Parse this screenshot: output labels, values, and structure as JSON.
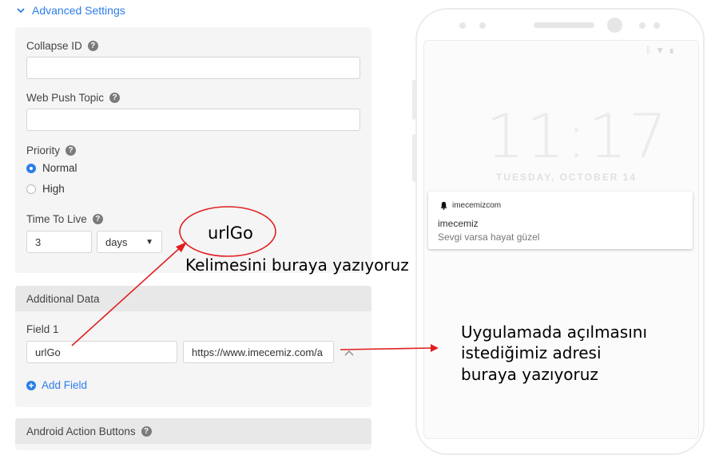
{
  "advanced_settings": {
    "label": "Advanced Settings"
  },
  "form": {
    "collapse_id": {
      "label": "Collapse ID",
      "value": ""
    },
    "web_push_topic": {
      "label": "Web Push Topic",
      "value": ""
    },
    "priority": {
      "label": "Priority",
      "options": [
        "Normal",
        "High"
      ],
      "selected": "Normal"
    },
    "time_to_live": {
      "label": "Time To Live",
      "value": "3",
      "unit": "days"
    }
  },
  "additional_data": {
    "title": "Additional Data",
    "field_label": "Field 1",
    "key": "urlGo",
    "value": "https://www.imecemiz.com/a",
    "add_field": "Add Field"
  },
  "android_action_buttons": {
    "title": "Android Action Buttons"
  },
  "phone": {
    "time": "11:17",
    "date": "TUESDAY, OCTOBER 14",
    "notification": {
      "app": "imecemizcom",
      "title": "imecemiz",
      "body": "Sevgi varsa hayat güzel"
    }
  },
  "annotations": {
    "circle_word": "urlGo",
    "left_note": "Kelimesini buraya yazıyoruz",
    "right_note": [
      "Uygulamada açılmasını",
      "istediğimiz adresi",
      "buraya yazıyoruz"
    ]
  },
  "colors": {
    "accent": "#2b7de9",
    "annotation_red": "#e02020"
  }
}
